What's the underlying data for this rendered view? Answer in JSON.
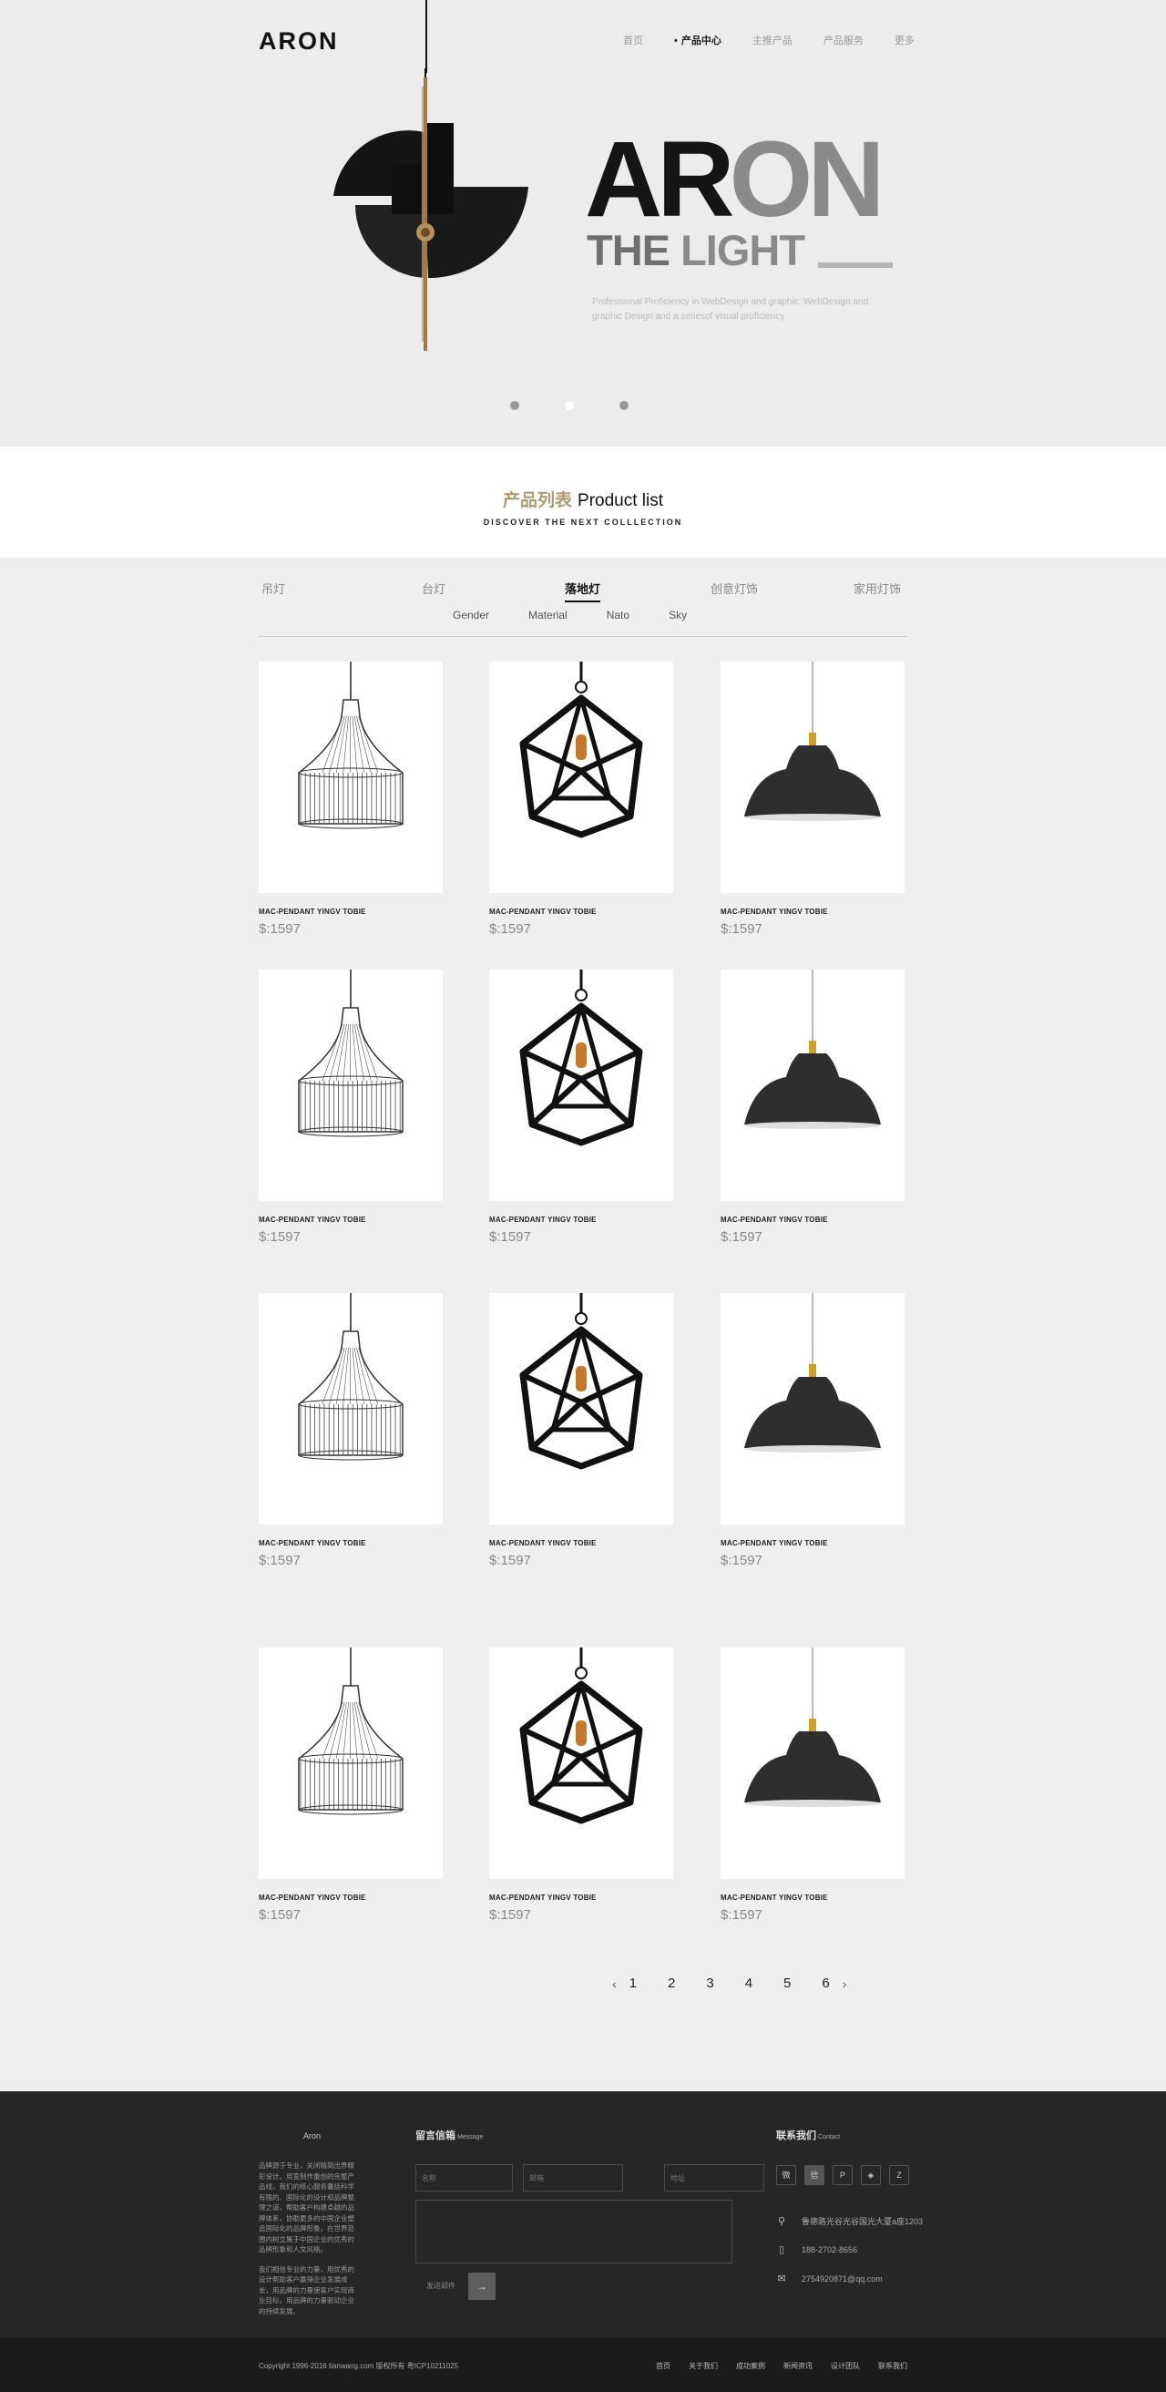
{
  "header": {
    "logo": "ARON",
    "nav": [
      "首页",
      "产品中心",
      "主推产品",
      "产品服务",
      "更多"
    ],
    "active_nav": 1
  },
  "hero": {
    "big_dark": "AR",
    "big_light": "ON",
    "line2_a": "THE ",
    "line2_b": "LIGHT",
    "description": "Professional Proficiency in WebDesign and graphic. WebDesign and graphic Design and a seriesof visual  proficiency",
    "slides": 3,
    "active_slide": 1
  },
  "product_list": {
    "title_cn": "产品列表",
    "title_en": "Product list",
    "subtitle": "DISCOVER THE NEXT COLLLECTION"
  },
  "categories": [
    "吊灯",
    "台灯",
    "落地灯",
    "创意灯饰",
    "家用灯饰"
  ],
  "active_category": 2,
  "subcategories": [
    "Gender",
    "Material",
    "Nato",
    "Sky"
  ],
  "products": [
    {
      "name": "MAC-PENDANT YINGV TOBIE",
      "price": "$:1597",
      "icon": "cage-pendant-lamp-icon"
    },
    {
      "name": "MAC-PENDANT YINGV TOBIE",
      "price": "$:1597",
      "icon": "geometric-pendant-lamp-icon"
    },
    {
      "name": "MAC-PENDANT YINGV TOBIE",
      "price": "$:1597",
      "icon": "dome-pendant-lamp-icon"
    },
    {
      "name": "MAC-PENDANT YINGV TOBIE",
      "price": "$:1597",
      "icon": "cage-pendant-lamp-icon"
    },
    {
      "name": "MAC-PENDANT YINGV TOBIE",
      "price": "$:1597",
      "icon": "geometric-pendant-lamp-icon"
    },
    {
      "name": "MAC-PENDANT YINGV TOBIE",
      "price": "$:1597",
      "icon": "dome-pendant-lamp-icon"
    },
    {
      "name": "MAC-PENDANT YINGV TOBIE",
      "price": "$:1597",
      "icon": "cage-pendant-lamp-icon"
    },
    {
      "name": "MAC-PENDANT YINGV TOBIE",
      "price": "$:1597",
      "icon": "geometric-pendant-lamp-icon"
    },
    {
      "name": "MAC-PENDANT YINGV TOBIE",
      "price": "$:1597",
      "icon": "dome-pendant-lamp-icon"
    },
    {
      "name": "MAC-PENDANT YINGV TOBIE",
      "price": "$:1597",
      "icon": "cage-pendant-lamp-icon"
    },
    {
      "name": "MAC-PENDANT YINGV TOBIE",
      "price": "$:1597",
      "icon": "geometric-pendant-lamp-icon"
    },
    {
      "name": "MAC-PENDANT YINGV TOBIE",
      "price": "$:1597",
      "icon": "dome-pendant-lamp-icon"
    }
  ],
  "pagination": {
    "pages": [
      "1",
      "2",
      "3",
      "4",
      "5",
      "6"
    ],
    "prev": "‹",
    "next": "›"
  },
  "footer": {
    "brand": "Aron",
    "about_1": "品牌源于专业，关闭精简出界精彩设计。用宽制作重创的完整产品线，我们的核心服务囊括科学有限的、国际化的设计和品牌整理之道，帮助客户构建卓越的品牌体系，协助更多的中国企业塑造国际化的品牌形象，在世界范围内树立属于中国企业的优秀的品牌形象和人文风格。",
    "about_2": "我们相信专业的力量，用优秀的设计帮助客户赢得企业发展成长，用品牌的力量使客户实现商业目标，用品牌的力量驱动企业的持续发展。",
    "message_title": "留言信箱",
    "message_title_en": "Message",
    "name_placeholder": "名称",
    "email_placeholder": "邮箱",
    "address_placeholder": "地址",
    "send_label": "发送邮件",
    "send_arrow": "→",
    "contact_title": "联系我们",
    "contact_title_en": "Contact",
    "socials": [
      "微",
      "信",
      "P",
      "◈",
      "Z"
    ],
    "address": "鲁德路光谷光谷国光大厦a座1203",
    "phone": "188-2702-8656",
    "email": "2754920871@qq.com"
  },
  "copyright": {
    "text": "Copyright 1996-2016 tianwang.com 版权所有 粤ICP10211025",
    "links": [
      "首页",
      "关于我们",
      "成功案例",
      "新闻资讯",
      "设计团队",
      "联系我们"
    ]
  }
}
